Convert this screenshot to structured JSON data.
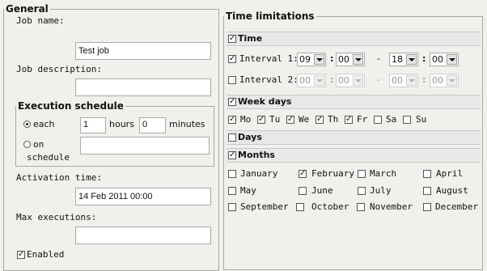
{
  "general": {
    "legend": "General",
    "job_name_label": "Job name:",
    "job_name_value": "Test job",
    "job_desc_label": "Job description:",
    "job_desc_value": "",
    "exec": {
      "legend": "Execution schedule",
      "each_label": "each",
      "hours_value": "1",
      "hours_label": "hours",
      "minutes_value": "0",
      "minutes_label": "minutes",
      "on_schedule_label_1": "on",
      "on_schedule_label_2": "schedule",
      "schedule_value": "",
      "selected": "each"
    },
    "activation_label": "Activation time:",
    "activation_value": "14 Feb 2011 00:00",
    "max_exec_label": "Max executions:",
    "max_exec_value": "",
    "enabled_label": "Enabled",
    "enabled_checked": true
  },
  "limits": {
    "legend": "Time limitations",
    "time": {
      "label": "Time",
      "checked": true,
      "interval1": {
        "label": "Interval 1:",
        "checked": true,
        "h1": "09",
        "m1": "00",
        "h2": "18",
        "m2": "00",
        "dash": "-"
      },
      "interval2": {
        "label": "Interval 2:",
        "checked": false,
        "h1": "00",
        "m1": "00",
        "h2": "00",
        "m2": "00",
        "dash": "-"
      }
    },
    "weekdays": {
      "label": "Week days",
      "checked": true,
      "days": [
        {
          "label": "Mo",
          "checked": true
        },
        {
          "label": "Tu",
          "checked": true
        },
        {
          "label": "We",
          "checked": true
        },
        {
          "label": "Th",
          "checked": true
        },
        {
          "label": "Fr",
          "checked": false
        },
        {
          "label": "Sa",
          "checked": false
        },
        {
          "label": "Su",
          "checked": false
        }
      ]
    },
    "days": {
      "label": "Days",
      "checked": false
    },
    "months": {
      "label": "Months",
      "checked": true,
      "list": [
        {
          "label": "January",
          "checked": false
        },
        {
          "label": "February",
          "checked": true
        },
        {
          "label": "March",
          "checked": false
        },
        {
          "label": "April",
          "checked": false
        },
        {
          "label": "May",
          "checked": false
        },
        {
          "label": "June",
          "checked": false
        },
        {
          "label": "July",
          "checked": false
        },
        {
          "label": "August",
          "checked": false
        },
        {
          "label": "September",
          "checked": false
        },
        {
          "label": "October",
          "checked": false
        },
        {
          "label": "November",
          "checked": false
        },
        {
          "label": "December",
          "checked": false
        }
      ]
    }
  }
}
